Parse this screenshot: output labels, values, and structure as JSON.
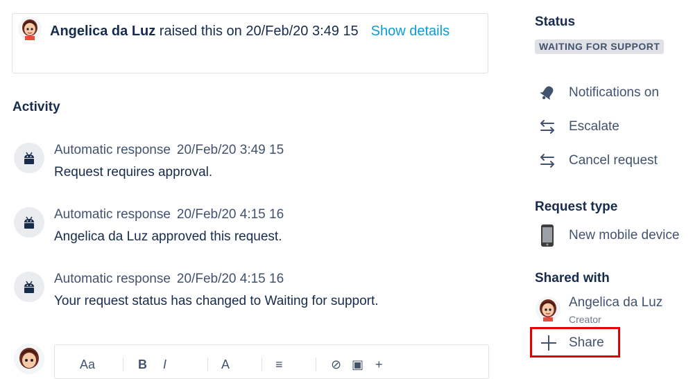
{
  "raised": {
    "author": "Angelica da Luz",
    "text": " raised this on 20/Feb/20 3:49 15",
    "show_details": "Show details"
  },
  "activity": {
    "heading": "Activity",
    "items": [
      {
        "author": "Automatic response",
        "date": "20/Feb/20 3:49 15",
        "body": "Request requires approval."
      },
      {
        "author": "Automatic response",
        "date": "20/Feb/20 4:15 16",
        "body": "Angelica da Luz approved this request."
      },
      {
        "author": "Automatic response",
        "date": "20/Feb/20 4:15 16",
        "body": "Your request status has changed to Waiting for support."
      }
    ]
  },
  "editor": {
    "toolbar": [
      "Aa",
      "B",
      "I",
      "A",
      "≡",
      "⊘",
      "▣",
      "+"
    ]
  },
  "sidebar": {
    "status_heading": "Status",
    "status_value": "WAITING FOR SUPPORT",
    "actions": [
      {
        "label": "Notifications on",
        "icon": "bell-icon"
      },
      {
        "label": "Escalate",
        "icon": "swap-arrows-icon"
      },
      {
        "label": "Cancel request",
        "icon": "swap-arrows-icon"
      }
    ],
    "request_type_heading": "Request type",
    "request_type": {
      "label": "New mobile device",
      "icon": "mobile-phone-icon"
    },
    "shared_with_heading": "Shared with",
    "shared_user": {
      "name": "Angelica da Luz",
      "role": "Creator"
    },
    "share_label": "Share"
  },
  "colors": {
    "link": "#0b9cd8",
    "text": "#172b4d",
    "muted": "#42526e",
    "highlight": "#e00000",
    "badge_bg": "#dfe1e6"
  }
}
